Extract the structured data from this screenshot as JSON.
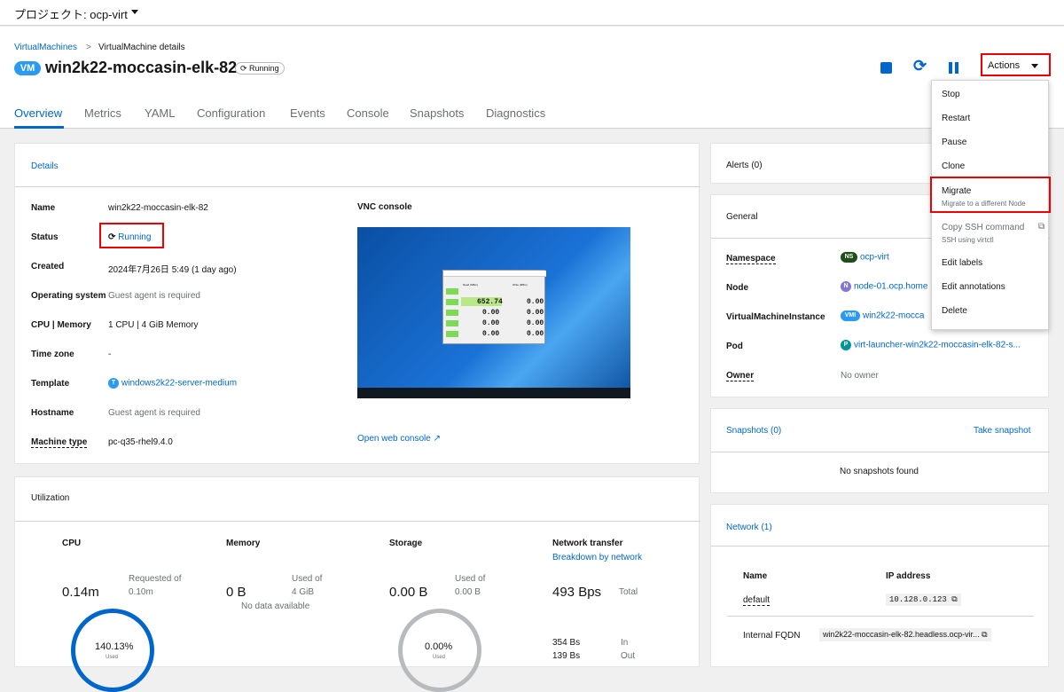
{
  "topbar": {
    "project_label": "プロジェクト: ocp-virt"
  },
  "breadcrumb": {
    "parent": "VirtualMachines",
    "sep": ">",
    "current": "VirtualMachine details"
  },
  "vm": {
    "badge": "VM",
    "name": "win2k22-moccasin-elk-82",
    "status": "Running"
  },
  "header": {
    "actions_label": "Actions"
  },
  "tabs": [
    "Overview",
    "Metrics",
    "YAML",
    "Configuration",
    "Events",
    "Console",
    "Snapshots",
    "Diagnostics"
  ],
  "details": {
    "title": "Details",
    "rows": [
      {
        "label": "Name",
        "value": "win2k22-moccasin-elk-82"
      },
      {
        "label": "Status",
        "value": "Running"
      },
      {
        "label": "Created",
        "value": "2024年7月26日 5:49 (1 day ago)"
      },
      {
        "label": "Operating system",
        "value": "Guest agent is required"
      },
      {
        "label": "CPU | Memory",
        "value": "1 CPU | 4 GiB Memory"
      },
      {
        "label": "Time zone",
        "value": "-"
      },
      {
        "label": "Template",
        "value": "windows2k22-server-medium",
        "badge": "T"
      },
      {
        "label": "Hostname",
        "value": "Guest agent is required"
      },
      {
        "label": "Machine type",
        "value": "pc-q35-rhel9.4.0"
      }
    ],
    "vnc_title": "VNC console",
    "open_web_console": "Open web console",
    "vnc_table": {
      "headers": [
        "Read (MB/s)",
        "Write (MB/s)"
      ],
      "rows": [
        [
          "652.74",
          "0.00"
        ],
        [
          "0.00",
          "0.00"
        ],
        [
          "0.00",
          "0.00"
        ],
        [
          "0.00",
          "0.00"
        ]
      ]
    }
  },
  "utilization": {
    "title": "Utilization",
    "cpu": {
      "title": "CPU",
      "value": "0.14m",
      "sub1": "Requested of",
      "sub2": "0.10m",
      "gauge": "140.13%",
      "gauge_sub": "Used"
    },
    "memory": {
      "title": "Memory",
      "value": "0 B",
      "sub1": "Used of",
      "sub2": "4 GiB",
      "nodata": "No data available"
    },
    "storage": {
      "title": "Storage",
      "value": "0.00 B",
      "sub1": "Used of",
      "sub2": "0.00 B",
      "gauge": "0.00%",
      "gauge_sub": "Used"
    },
    "network": {
      "title": "Network transfer",
      "link": "Breakdown by network",
      "value": "493 Bps",
      "total": "Total",
      "in_val": "354 Bs",
      "in": "In",
      "out_val": "139 Bs",
      "out": "Out"
    }
  },
  "alerts": {
    "title": "Alerts (0)"
  },
  "general": {
    "title": "General",
    "rows": [
      {
        "label": "Namespace",
        "badge": "NS",
        "value": "ocp-virt"
      },
      {
        "label": "Node",
        "badge": "N",
        "value": "node-01.ocp.home"
      },
      {
        "label": "VirtualMachineInstance",
        "badge": "VMI",
        "value": "win2k22-mocca"
      },
      {
        "label": "Pod",
        "badge": "P",
        "value": "virt-launcher-win2k22-moccasin-elk-82-s..."
      },
      {
        "label": "Owner",
        "badge": "",
        "value": "No owner"
      }
    ]
  },
  "snapshots": {
    "title": "Snapshots (0)",
    "take": "Take snapshot",
    "empty": "No snapshots found"
  },
  "network": {
    "title": "Network (1)",
    "col_name": "Name",
    "col_ip": "IP address",
    "row_name": "default",
    "row_ip": "10.128.0.123",
    "fqdn_label": "Internal FQDN",
    "fqdn_value": "win2k22-moccasin-elk-82.headless.ocp-vir..."
  },
  "actions_menu": {
    "items": [
      {
        "label": "Stop"
      },
      {
        "label": "Restart"
      },
      {
        "label": "Pause"
      },
      {
        "label": "Clone"
      },
      {
        "label": "Migrate",
        "desc": "Migrate to a different Node"
      },
      {
        "label": "Copy SSH command",
        "desc": "SSH using virtctl"
      },
      {
        "label": "Edit labels"
      },
      {
        "label": "Edit annotations"
      },
      {
        "label": "Delete"
      }
    ]
  },
  "colors": {
    "accent": "#0066cc",
    "highlight": "#e00000",
    "vm_badge": "#2b9af3",
    "cpu_gauge": "#0066cc"
  }
}
